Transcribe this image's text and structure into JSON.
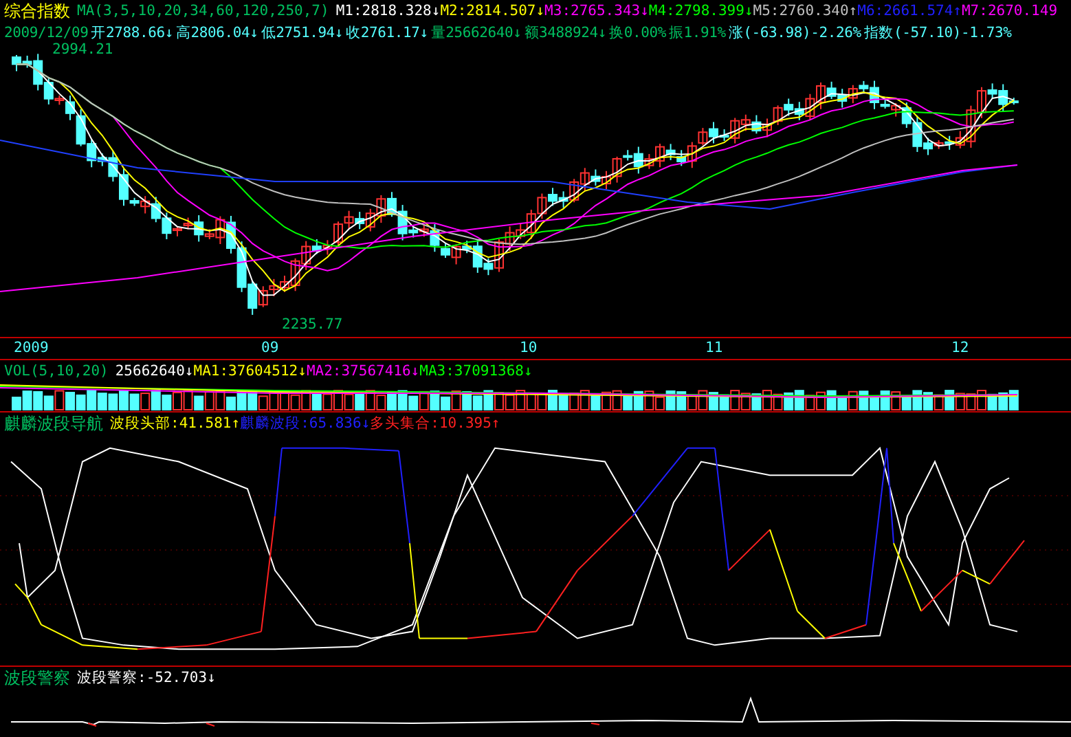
{
  "header": {
    "title": "综合指数",
    "ma_params": "MA(3,5,10,20,34,60,120,250,7)",
    "values": [
      {
        "text": "M1:2818.328↓",
        "color": "#ffffff"
      },
      {
        "text": "M2:2814.507↓",
        "color": "#ffff00"
      },
      {
        "text": "M3:2765.343↓",
        "color": "#ff00ff"
      },
      {
        "text": "M4:2798.399↓",
        "color": "#00ff00"
      },
      {
        "text": "M5:2760.340↑",
        "color": "#c0c0c0"
      },
      {
        "text": "M6:2661.574↑",
        "color": "#2020ff"
      },
      {
        "text": "M7:2670.149",
        "color": "#ff00ff"
      }
    ]
  },
  "quote": {
    "date": "2009/12/09",
    "items": [
      {
        "text": "开2788.66↓",
        "color": "#54ffff"
      },
      {
        "text": "高2806.04↓",
        "color": "#54ffff"
      },
      {
        "text": "低2751.94↓",
        "color": "#54ffff"
      },
      {
        "text": "收2761.17↓",
        "color": "#54ffff"
      },
      {
        "text": "量25662640↓",
        "color": "#00c060"
      },
      {
        "text": "额3488924↓",
        "color": "#00c060"
      },
      {
        "text": "换0.00%",
        "color": "#00c060"
      },
      {
        "text": "振1.91%",
        "color": "#00c060"
      },
      {
        "text": "涨(-63.98)-2.26%",
        "color": "#54ffff"
      },
      {
        "text": "指数(-57.10)-1.73%",
        "color": "#54ffff"
      }
    ]
  },
  "price_chart": {
    "high_label": "2994.21",
    "low_label": "2235.77",
    "axis_labels": [
      "2009",
      "09",
      "10",
      "11",
      "12"
    ]
  },
  "volume": {
    "label": "VOL(5,10,20)",
    "items": [
      {
        "text": "25662640↓",
        "color": "#ffffff"
      },
      {
        "text": "MA1:37604512↓",
        "color": "#ffff00"
      },
      {
        "text": "MA2:37567416↓",
        "color": "#ff00ff"
      },
      {
        "text": "MA3:37091368↓",
        "color": "#00ff00"
      }
    ]
  },
  "wave": {
    "label": "麒麟波段导航",
    "items": [
      {
        "text": "波段头部:41.581↑",
        "color": "#ffff00"
      },
      {
        "text": "麒麟波段:65.836↓",
        "color": "#2020ff"
      },
      {
        "text": "多头集合:10.395↑",
        "color": "#ff2020"
      }
    ]
  },
  "police": {
    "label": "波段警察",
    "items": [
      {
        "text": "波段警察:-52.703↓",
        "color": "#ffffff"
      }
    ]
  }
}
